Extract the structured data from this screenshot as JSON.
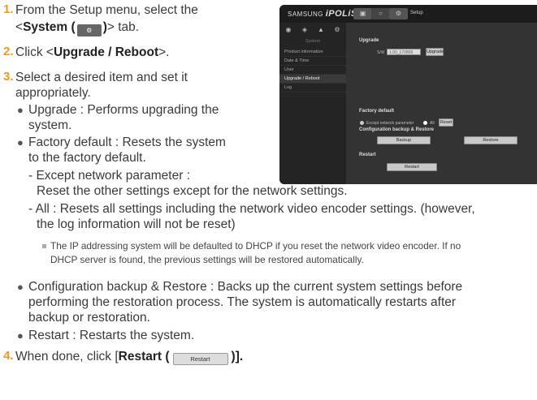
{
  "steps": [
    {
      "num": "1.",
      "pre": "From the Setup menu, select the",
      "line2_pre": "<",
      "bold": "System (",
      "tab_icon": "gear-tab-icon",
      "bold_end": ")",
      "line2_post": "> tab."
    },
    {
      "num": "2.",
      "pre": "Click <",
      "bold": "Upgrade / Reboot",
      "post": ">."
    },
    {
      "num": "3.",
      "line1": "Select a desired item and set it",
      "line2": "appropriately."
    },
    {
      "num": "4.",
      "pre": "When done, click [",
      "bold": "Restart (",
      "button": "Restart",
      "post": ")]."
    }
  ],
  "bullets": {
    "upgrade": [
      "Upgrade : Performs upgrading the",
      "system."
    ],
    "factory": [
      "Factory default : Resets the system",
      "to the factory default."
    ],
    "except": [
      "- Except network parameter :",
      "Reset the other settings except for the network settings."
    ],
    "all": [
      "- All : Resets all settings including the network video encoder settings. (however,",
      "the log information will not be reset)"
    ],
    "note": [
      "The IP addressing system will be defaulted to DHCP if you reset the network video encoder. If no",
      "DHCP server is found, the previous settings will be restored automatically."
    ],
    "backup": [
      "Configuration backup & Restore : Backs up the current system settings before",
      "performing the restoration process. The system is automatically restarts after",
      "backup or restoration."
    ],
    "restart": [
      "Restart : Restarts the system."
    ]
  },
  "screenshot": {
    "brand": "SAMSUNG",
    "logo": "iPOLiS",
    "setup": "Setup",
    "top_icons": [
      "monitor-icon",
      "circle-icon",
      "gear-icon"
    ],
    "side_tabs": [
      "video-icon",
      "network-icon",
      "event-icon",
      "system-icon"
    ],
    "side_subtitle": "System",
    "side_items": [
      "Product information",
      "Date & Time",
      "User",
      "Upgrade / Reboot",
      "Log"
    ],
    "active_item": "Upgrade / Reboot",
    "upgrade_title": "Upgrade",
    "sw_label": "S/W",
    "sw_value": "1.00_170809",
    "upgrade_btn": "Upgrade",
    "factory_title": "Factory default",
    "except_label": "Except network parameter",
    "all_label": "All",
    "reset_btn": "Reset",
    "config_title": "Configuration backup & Restore",
    "backup_btn": "Backup",
    "restore_btn": "Restore",
    "restart_title": "Restart",
    "restart_btn": "Restart"
  },
  "colors": {
    "step_number": "#f29a1e",
    "panel_bg": "#2b2b2b",
    "text": "#3a3a3a"
  }
}
